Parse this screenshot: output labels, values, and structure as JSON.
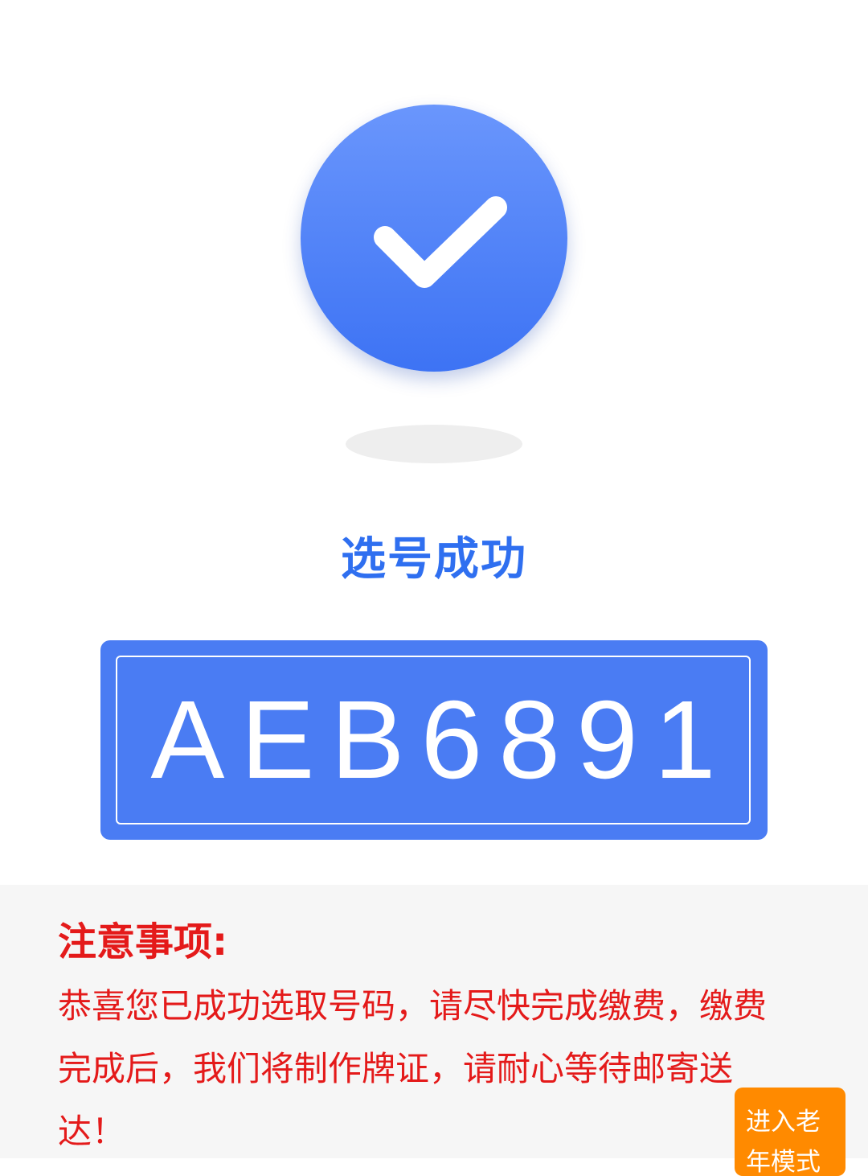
{
  "header": {
    "icon": "check-circle-icon",
    "title": "选号成功"
  },
  "plate": {
    "number": "AEB6891"
  },
  "notice": {
    "title": "注意事项:",
    "body": "恭喜您已成功选取号码，请尽快完成缴费，缴费完成后，我们将制作牌证，请耐心等待邮寄送达！"
  },
  "elder_mode_button": {
    "label": "进入老年模式"
  },
  "colors": {
    "accent": "#2f6ff0",
    "plate_bg": "#4a7cf3",
    "warning": "#e41a1a",
    "button": "#ff8a00"
  }
}
